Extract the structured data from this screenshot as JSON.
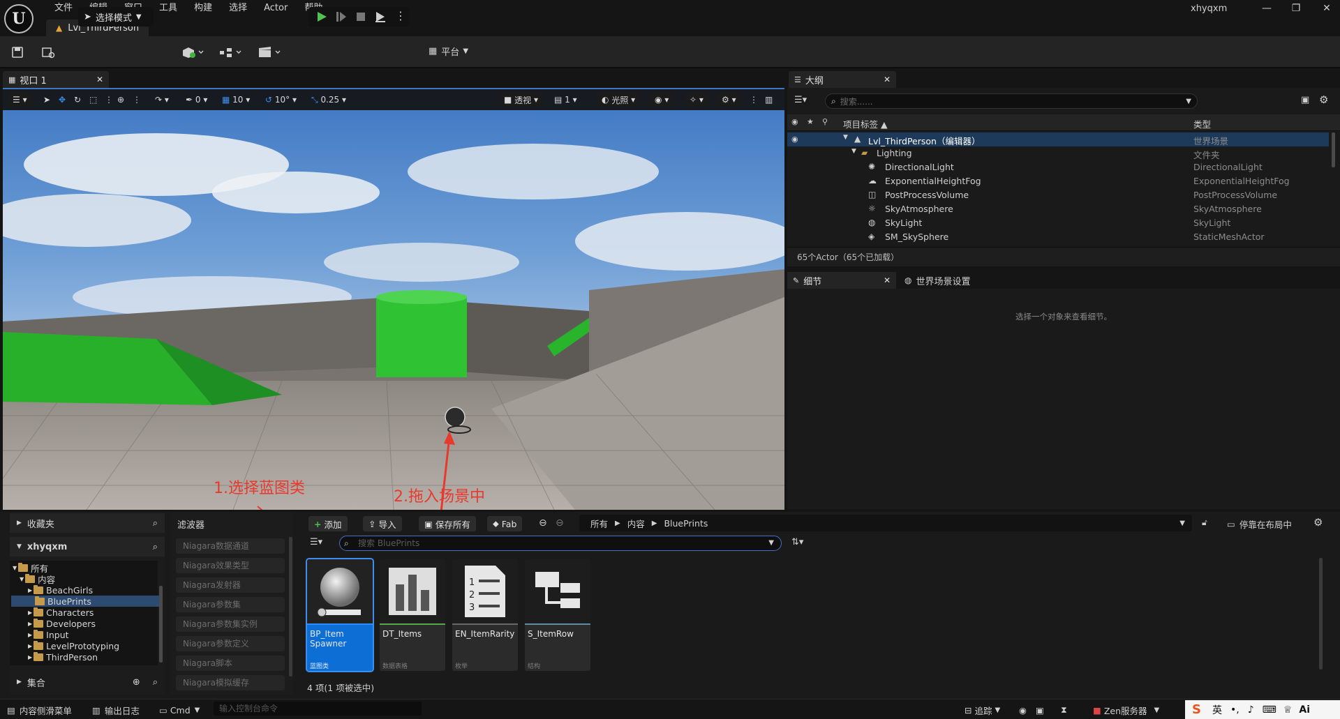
{
  "app": {
    "menu": [
      "文件",
      "编辑",
      "窗口",
      "工具",
      "构建",
      "选择",
      "Actor",
      "帮助"
    ],
    "level_tab": "Lvl_ThirdPerson",
    "user": "xhyqxm",
    "window_controls": [
      "—",
      "❐",
      "✕"
    ]
  },
  "toolbar": {
    "mode_select": "选择模式",
    "platform": "平台"
  },
  "viewport": {
    "tab_label": "视口 1",
    "snap_rotation": "0",
    "grid_size": "10",
    "rotation_snap": "10°",
    "scale_snap": "0.25",
    "perspective": "透视",
    "camera_speed": "1",
    "lighting": "光照",
    "annotations": [
      "1.选择蓝图类",
      "2.拖入场景中"
    ]
  },
  "outliner": {
    "tab_label": "大纲",
    "search_placeholder": "搜索......",
    "col_label": "项目标签 ▲",
    "col_type": "类型",
    "rows": [
      {
        "name": "Lvl_ThirdPerson（编辑器）",
        "type": "世界场景",
        "icon": "level-icon"
      },
      {
        "name": "Lighting",
        "type": "文件夹",
        "icon": "folder-icon"
      },
      {
        "name": "DirectionalLight",
        "type": "DirectionalLight",
        "icon": "sun-icon"
      },
      {
        "name": "ExponentialHeightFog",
        "type": "ExponentialHeightFog",
        "icon": "fog-icon"
      },
      {
        "name": "PostProcessVolume",
        "type": "PostProcessVolume",
        "icon": "volume-icon"
      },
      {
        "name": "SkyAtmosphere",
        "type": "SkyAtmosphere",
        "icon": "atmosphere-icon"
      },
      {
        "name": "SkyLight",
        "type": "SkyLight",
        "icon": "skylight-icon"
      },
      {
        "name": "SM_SkySphere",
        "type": "StaticMeshActor",
        "icon": "mesh-icon"
      }
    ],
    "footer": "65个Actor（65个已加载）"
  },
  "details": {
    "tab_label": "细节",
    "world_tab_label": "世界场景设置",
    "hint": "选择一个对象来查看细节。"
  },
  "content_browser": {
    "favorites": "收藏夹",
    "root": "xhyqxm",
    "tree": [
      {
        "label": "所有",
        "depth": 0,
        "open": true
      },
      {
        "label": "内容",
        "depth": 1,
        "open": true
      },
      {
        "label": "BeachGirls",
        "depth": 2
      },
      {
        "label": "BluePrints",
        "depth": 2,
        "selected": true
      },
      {
        "label": "Characters",
        "depth": 2
      },
      {
        "label": "Developers",
        "depth": 2
      },
      {
        "label": "Input",
        "depth": 2
      },
      {
        "label": "LevelPrototyping",
        "depth": 2
      },
      {
        "label": "ThirdPerson",
        "depth": 2
      }
    ],
    "collections": "集合",
    "filters_title": "滤波器",
    "filters": [
      "Niagara数据通道",
      "Niagara效果类型",
      "Niagara发射器",
      "Niagara参数集",
      "Niagara参数集实例",
      "Niagara参数定义",
      "Niagara脚本",
      "Niagara模拟缓存"
    ],
    "add_label": "添加",
    "import_label": "导入",
    "save_all_label": "保存所有",
    "fab_label": "Fab",
    "breadcrumb": [
      "所有",
      "内容",
      "BluePrints"
    ],
    "dock_label": "停靠在布局中",
    "search_placeholder": "搜索 BluePrints",
    "assets": [
      {
        "name": "BP_Item Spawner",
        "type": "蓝图类",
        "bar": "#2f8cff",
        "selected": true
      },
      {
        "name": "DT_Items",
        "type": "数据表格",
        "bar": "#58a84a"
      },
      {
        "name": "EN_ItemRarity",
        "type": "枚举",
        "bar": "#6a6a6a"
      },
      {
        "name": "S_ItemRow",
        "type": "结构",
        "bar": "#5e8ea0"
      }
    ],
    "item_count": "4 项(1 项被选中)"
  },
  "statusbar": {
    "drawer": "内容侧滑菜单",
    "output_log": "输出日志",
    "cmd": "Cmd",
    "console_placeholder": "输入控制台命令",
    "trace": "追踪",
    "zen": "Zen服务器",
    "ime_lang": "英"
  }
}
